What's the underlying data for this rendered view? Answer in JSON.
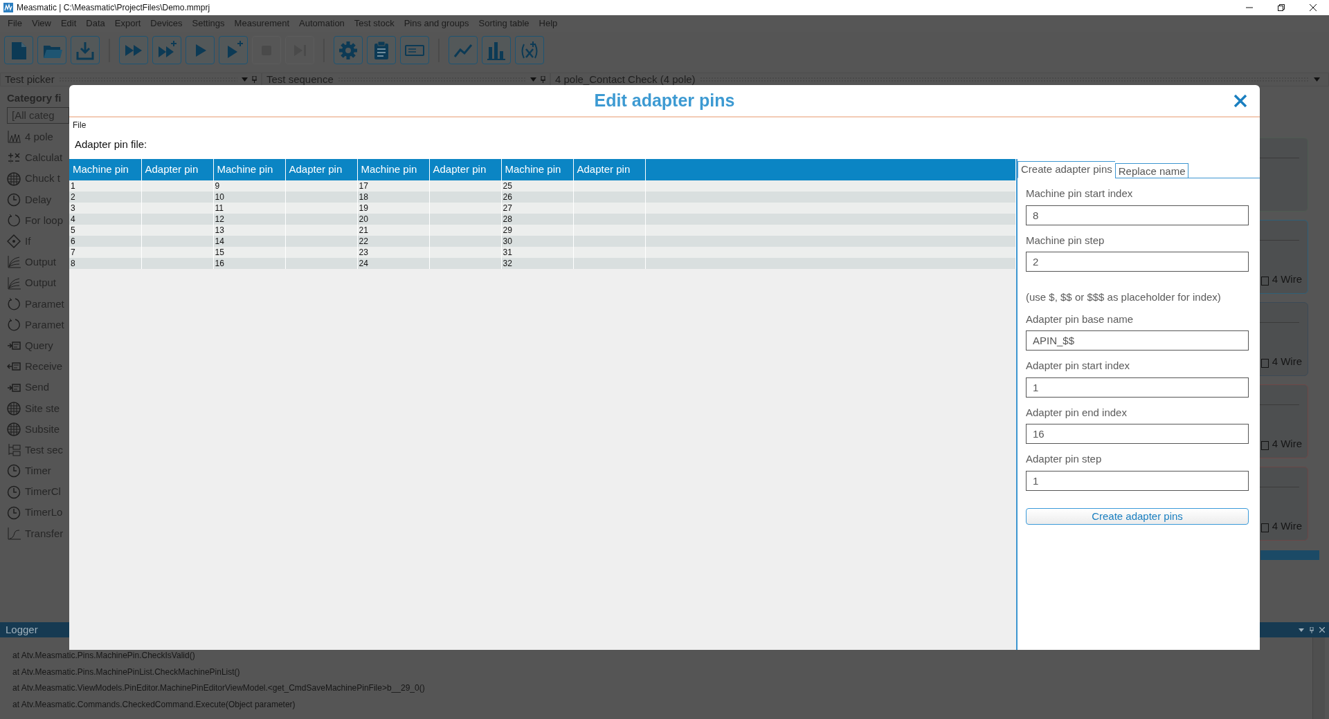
{
  "window": {
    "title": "Measmatic | C:\\Measmatic\\ProjectFiles\\Demo.mmprj"
  },
  "menu": [
    "File",
    "View",
    "Edit",
    "Data",
    "Export",
    "Devices",
    "Settings",
    "Measurement",
    "Automation",
    "Test stock",
    "Pins and groups",
    "Sorting table",
    "Help"
  ],
  "toolbar": [
    {
      "kind": "new",
      "disabled": false
    },
    {
      "kind": "open",
      "disabled": false
    },
    {
      "kind": "download",
      "disabled": false
    },
    {
      "kind": "sep"
    },
    {
      "kind": "run-all",
      "disabled": false
    },
    {
      "kind": "run-all-add",
      "disabled": false
    },
    {
      "kind": "run",
      "disabled": false
    },
    {
      "kind": "run-add",
      "disabled": false
    },
    {
      "kind": "stop",
      "disabled": true
    },
    {
      "kind": "step",
      "disabled": true
    },
    {
      "kind": "sep"
    },
    {
      "kind": "settings",
      "disabled": false
    },
    {
      "kind": "clipboard",
      "disabled": false
    },
    {
      "kind": "device",
      "disabled": false
    },
    {
      "kind": "sep"
    },
    {
      "kind": "line-chart",
      "disabled": false
    },
    {
      "kind": "bar-chart",
      "disabled": false
    },
    {
      "kind": "formula",
      "disabled": false
    }
  ],
  "test_picker": {
    "title": "Test picker",
    "category_label": "Category fi",
    "category_field": "[All categ",
    "items": [
      {
        "label": "4 pole",
        "kind": "chart"
      },
      {
        "label": "Calculat",
        "kind": "calc"
      },
      {
        "label": "Chuck t",
        "kind": "grid"
      },
      {
        "label": "Delay",
        "kind": "clock"
      },
      {
        "label": "For loop",
        "kind": "loop"
      },
      {
        "label": "If",
        "kind": "diamond"
      },
      {
        "label": "Output",
        "kind": "curve"
      },
      {
        "label": "Output",
        "kind": "curve"
      },
      {
        "label": "Paramet",
        "kind": "loop"
      },
      {
        "label": "Paramet",
        "kind": "loop"
      },
      {
        "label": "Query",
        "kind": "send"
      },
      {
        "label": "Receive",
        "kind": "receive"
      },
      {
        "label": "Send",
        "kind": "send"
      },
      {
        "label": "Site ste",
        "kind": "grid"
      },
      {
        "label": "Subsite",
        "kind": "grid"
      },
      {
        "label": "Test sec",
        "kind": "tree"
      },
      {
        "label": "Timer",
        "kind": "clock"
      },
      {
        "label": "TimerCl",
        "kind": "clock"
      },
      {
        "label": "TimerLo",
        "kind": "clock"
      },
      {
        "label": "Transfer",
        "kind": "transfer"
      }
    ]
  },
  "test_sequence": {
    "title": "Test sequence"
  },
  "test_view": {
    "title": "4 pole_Contact Check (4 pole)",
    "cards": [
      {
        "color": "#4e5b52"
      },
      {
        "label": "4 Wire",
        "color": "#2f6078"
      },
      {
        "label": "4 Wire",
        "color": "#3c4a56"
      },
      {
        "label": "4 Wire",
        "color": "#6e4747"
      },
      {
        "label": "4 Wire",
        "color": "#6a4646"
      }
    ]
  },
  "logger": {
    "title": "Logger",
    "lines": [
      "at Atv.Measmatic.Pins.MachinePin.CheckIsValid()",
      "at Atv.Measmatic.Pins.MachinePinList.CheckMachinePinList()",
      "at Atv.Measmatic.ViewModels.PinEditor.MachinePinEditorViewModel.<get_CmdSaveMachinePinFile>b__29_0()",
      "at Atv.Measmatic.Commands.CheckedCommand.Execute(Object parameter)"
    ]
  },
  "dialog": {
    "title": "Edit adapter pins",
    "menu": [
      "File"
    ],
    "file_label": "Adapter pin file:",
    "table": {
      "columns": [
        "Machine pin",
        "Adapter pin",
        "Machine pin",
        "Adapter pin",
        "Machine pin",
        "Adapter pin",
        "Machine pin",
        "Adapter pin"
      ],
      "rows": [
        [
          "1",
          "",
          "9",
          "",
          "17",
          "",
          "25",
          ""
        ],
        [
          "2",
          "",
          "10",
          "",
          "18",
          "",
          "26",
          ""
        ],
        [
          "3",
          "",
          "11",
          "",
          "19",
          "",
          "27",
          ""
        ],
        [
          "4",
          "",
          "12",
          "",
          "20",
          "",
          "28",
          ""
        ],
        [
          "5",
          "",
          "13",
          "",
          "21",
          "",
          "29",
          ""
        ],
        [
          "6",
          "",
          "14",
          "",
          "22",
          "",
          "30",
          ""
        ],
        [
          "7",
          "",
          "15",
          "",
          "23",
          "",
          "31",
          ""
        ],
        [
          "8",
          "",
          "16",
          "",
          "24",
          "",
          "32",
          ""
        ]
      ]
    },
    "tabs": [
      {
        "label": "Create adapter pins",
        "selected": true
      },
      {
        "label": "Replace name",
        "selected": false
      }
    ],
    "fields": [
      {
        "label": "Machine pin start index",
        "value": "8"
      },
      {
        "label": "Machine pin step",
        "value": "2"
      },
      {
        "note": "(use $, $$ or $$$ as placeholder for index)",
        "label": "Adapter pin base name",
        "value": "APIN_$$"
      },
      {
        "label": "Adapter pin start index",
        "value": "1"
      },
      {
        "label": "Adapter pin end index",
        "value": "16"
      },
      {
        "label": "Adapter pin step",
        "value": "1"
      }
    ],
    "button": "Create adapter pins"
  }
}
